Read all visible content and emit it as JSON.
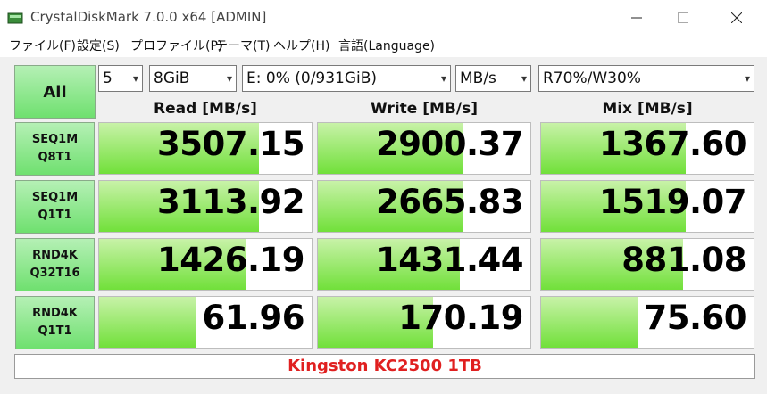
{
  "window": {
    "title": "CrystalDiskMark 7.0.0 x64 [ADMIN]",
    "minimize_icon": "minimize-icon",
    "maximize_icon": "maximize-icon",
    "close_icon": "close-icon"
  },
  "menu": [
    "ファイル(F)",
    "設定(S)",
    "プロファイル(P)",
    "テーマ(T)",
    "ヘルプ(H)",
    "言語(Language)"
  ],
  "controls": {
    "all_button": "All",
    "count": "5",
    "size": "8GiB",
    "drive": "E: 0% (0/931GiB)",
    "unit": "MB/s",
    "mix_ratio": "R70%/W30%"
  },
  "headers": {
    "read": "Read [MB/s]",
    "write": "Write [MB/s]",
    "mix": "Mix [MB/s]"
  },
  "rows": [
    {
      "line1": "SEQ1M",
      "line2": "Q8T1",
      "read": "3507.15",
      "write": "2900.37",
      "mix": "1367.60",
      "read_pct": 75,
      "write_pct": 68,
      "mix_pct": 68
    },
    {
      "line1": "SEQ1M",
      "line2": "Q1T1",
      "read": "3113.92",
      "write": "2665.83",
      "mix": "1519.07",
      "read_pct": 75,
      "write_pct": 68,
      "mix_pct": 68
    },
    {
      "line1": "RND4K",
      "line2": "Q32T16",
      "read": "1426.19",
      "write": "1431.44",
      "mix": "881.08",
      "read_pct": 69,
      "write_pct": 67,
      "mix_pct": 67
    },
    {
      "line1": "RND4K",
      "line2": "Q1T1",
      "read": "61.96",
      "write": "170.19",
      "mix": "75.60",
      "read_pct": 46,
      "write_pct": 54,
      "mix_pct": 46
    }
  ],
  "footer": {
    "comment": "Kingston KC2500 1TB",
    "comment_color": "#e02020"
  },
  "colors": {
    "bar_light": "#c8f2a8",
    "bar_dark": "#71e03a",
    "button_green": "#6fe06f"
  }
}
